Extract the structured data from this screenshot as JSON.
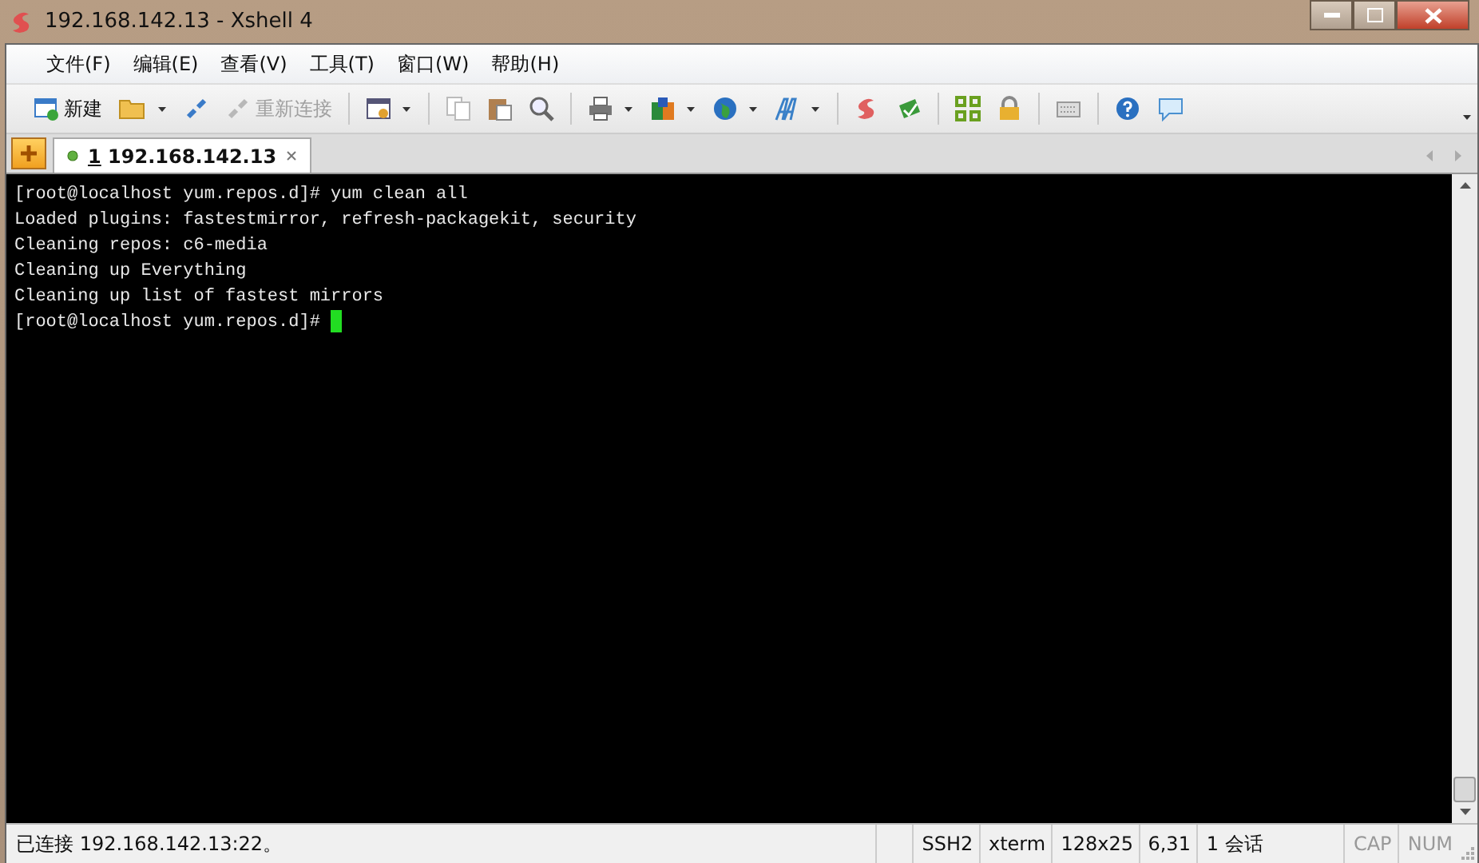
{
  "window": {
    "title": "192.168.142.13 - Xshell 4"
  },
  "menu": [
    "文件(F)",
    "编辑(E)",
    "查看(V)",
    "工具(T)",
    "窗口(W)",
    "帮助(H)"
  ],
  "toolbar": [
    {
      "kind": "new",
      "label": "新建",
      "disabled": false
    },
    {
      "kind": "reconnect",
      "label": "重新连接",
      "disabled": true
    }
  ],
  "tabs": [
    {
      "number": "1",
      "label": "192.168.142.13",
      "selected": true,
      "connected": true
    }
  ],
  "terminal": {
    "lines": [
      "[root@localhost yum.repos.d]# yum clean all",
      "Loaded plugins: fastestmirror, refresh-packagekit, security",
      "Cleaning repos: c6-media",
      "Cleaning up Everything",
      "Cleaning up list of fastest mirrors",
      "[root@localhost yum.repos.d]# "
    ]
  },
  "status_bar": {
    "message": "已连接 192.168.142.13:22。",
    "fields": [
      "SSH2",
      "xterm",
      "128x25",
      "6,31",
      "1 会话"
    ],
    "indicators": [
      {
        "label": "CAP",
        "on": false
      },
      {
        "label": "NUM",
        "on": false
      }
    ]
  }
}
